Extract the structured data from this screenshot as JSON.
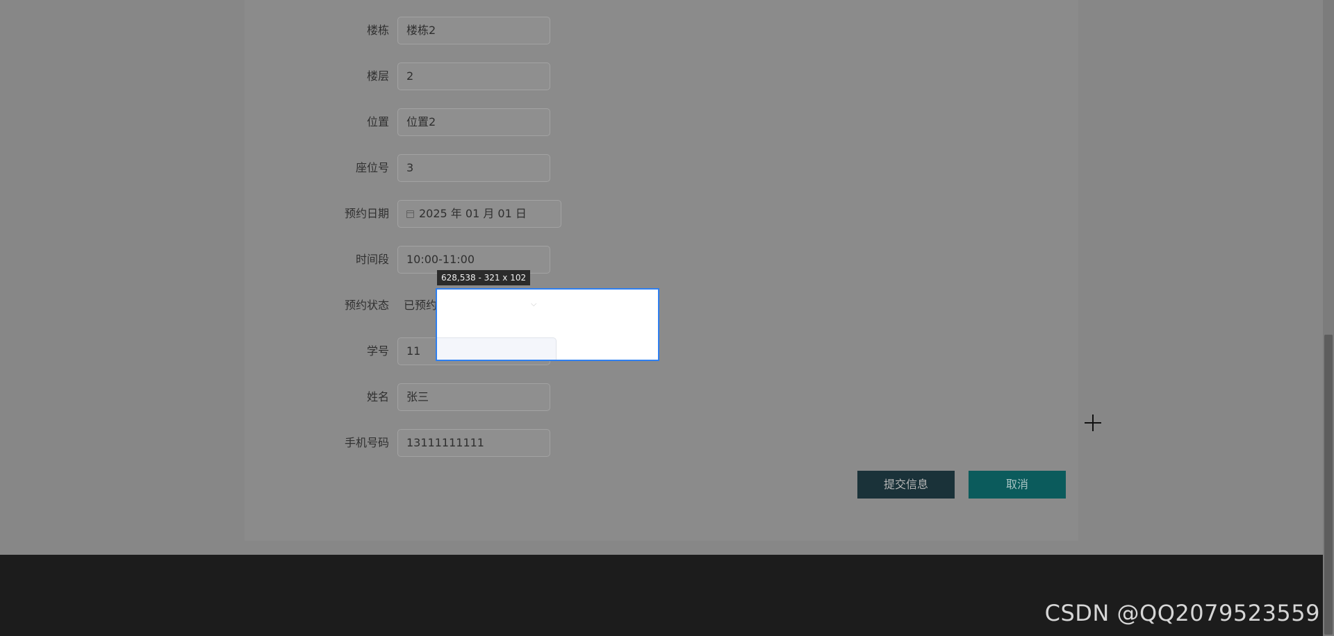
{
  "form": {
    "fields": [
      {
        "label": "楼栋",
        "value": "楼栋2"
      },
      {
        "label": "楼层",
        "value": "2"
      },
      {
        "label": "位置",
        "value": "位置2"
      },
      {
        "label": "座位号",
        "value": "3"
      },
      {
        "label": "预约日期",
        "value": "2025 年 01 月 01 日"
      },
      {
        "label": "时间段",
        "value": "10:00-11:00"
      },
      {
        "label": "预约状态",
        "value": "已预约"
      },
      {
        "label": "学号",
        "value": "11"
      },
      {
        "label": "姓名",
        "value": "张三"
      },
      {
        "label": "手机号码",
        "value": "13111111111"
      }
    ],
    "submit_label": "提交信息",
    "cancel_label": "取消"
  },
  "snip": {
    "tooltip": "628,538 - 321 x 102",
    "chevron": "⌵"
  },
  "footer": {
    "watermark": "CSDN @QQ2079523559"
  },
  "colors": {
    "selection_border": "#2e7ff0",
    "submit_bg": "#1a3239",
    "cancel_bg": "#0b5b5c",
    "footer_bg": "#1c1c1c"
  }
}
